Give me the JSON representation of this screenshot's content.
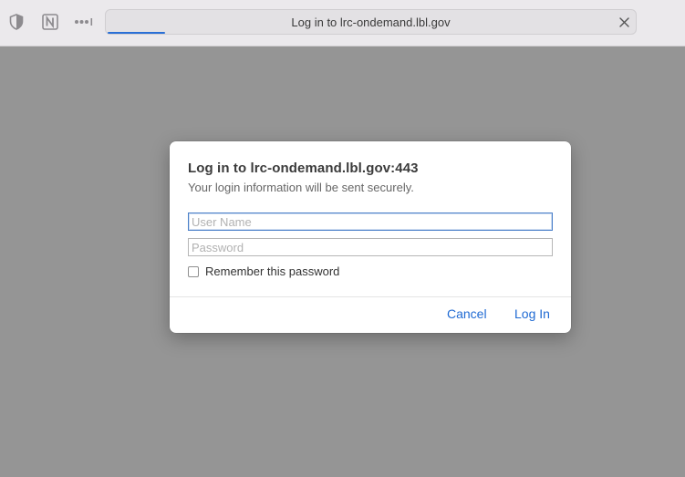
{
  "toolbar": {
    "icons": [
      "privacy-shield-icon",
      "notion-app-icon",
      "more-dots-icon"
    ],
    "address": {
      "title": "Log in to lrc-ondemand.lbl.gov",
      "close_icon": "close-icon",
      "loading_progress": 0.11
    }
  },
  "dialog": {
    "title": "Log in to lrc-ondemand.lbl.gov:443",
    "subtitle": "Your login information will be sent securely.",
    "username": {
      "placeholder": "User Name",
      "value": ""
    },
    "password": {
      "placeholder": "Password",
      "value": ""
    },
    "remember": {
      "label": "Remember this password",
      "checked": false
    },
    "cancel_label": "Cancel",
    "login_label": "Log In"
  },
  "colors": {
    "accent": "#1f6ad3",
    "background_overlay": "#959595",
    "toolbar": "#ebe9ec"
  }
}
